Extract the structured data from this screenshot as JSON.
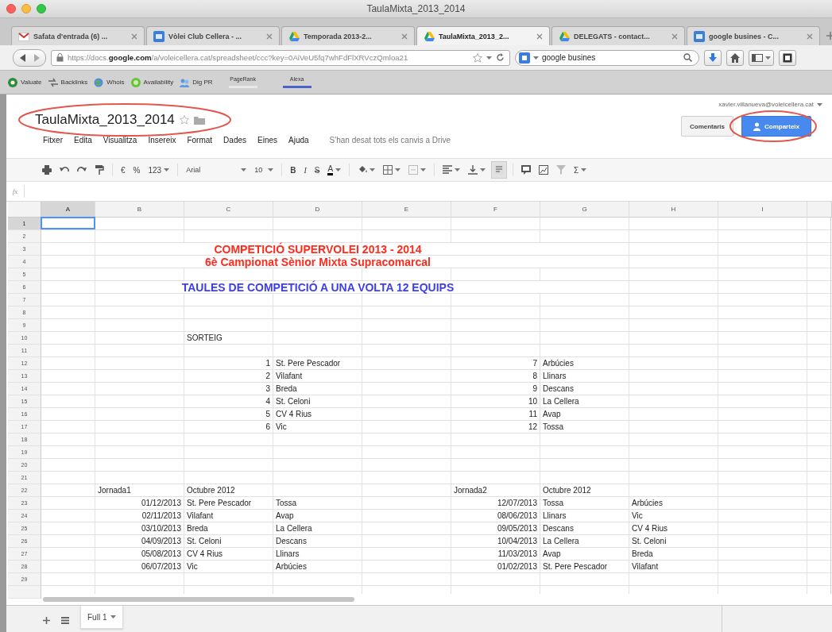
{
  "window": {
    "title": "TaulaMixta_2013_2014"
  },
  "tabs": [
    {
      "label": "Safata d'entrada (6) ...",
      "kind": "mail",
      "selected": false
    },
    {
      "label": "Vòlei Club Cellera - ...",
      "kind": "site",
      "selected": false
    },
    {
      "label": "Temporada 2013-2...",
      "kind": "drive",
      "selected": false
    },
    {
      "label": "TaulaMixta_2013_2...",
      "kind": "drive",
      "selected": true
    },
    {
      "label": "DELEGATS - contact...",
      "kind": "drive",
      "selected": false
    },
    {
      "label": "google busines - C...",
      "kind": "site",
      "selected": false
    }
  ],
  "address_bar": {
    "url": "https://docs.**google.com**/a/voleicellera.cat/spreadsheet/ccc?key=0AiVeU5fq7whFdFlXRVczQmloa21",
    "search": "google busines"
  },
  "bookmarks": [
    {
      "label": "Valuate",
      "kind": "link"
    },
    {
      "label": "Backlinks",
      "kind": "link"
    },
    {
      "label": "Whois",
      "kind": "link"
    },
    {
      "label": "Availability",
      "kind": "link"
    },
    {
      "label": "Dig PR",
      "kind": "link"
    },
    {
      "label": "PageRank",
      "kind": "meter",
      "color": "#e8e8e8"
    },
    {
      "label": "Alexa",
      "kind": "meter",
      "color": "#4a63c8"
    }
  ],
  "doc": {
    "title": "TaulaMixta_2013_2014",
    "title_highlighted": true,
    "account": "xavier.villanueva@voleicellera.cat",
    "menus": [
      "Fitxer",
      "Edita",
      "Visualitza",
      "Insereix",
      "Format",
      "Dades",
      "Eines",
      "Ajuda"
    ],
    "save_status": "S'han desat tots els canvis a Drive",
    "buttons": [
      {
        "label": "Comentaris",
        "kind": "plain",
        "highlighted": false
      },
      {
        "label": "Comparteix",
        "kind": "primary",
        "highlighted": true
      }
    ]
  },
  "toolbar": {
    "currency": "€",
    "percent": "%",
    "number_format": "123",
    "font": "Arial",
    "font_size": "10",
    "bold": "B",
    "italic": "I",
    "strikethrough": "S",
    "text_color": "A",
    "functions": "Σ"
  },
  "formula_bar": {
    "label": "fx"
  },
  "sheet": {
    "columns": [
      {
        "label": "A",
        "selected": true
      },
      {
        "label": "B",
        "selected": false
      },
      {
        "label": "C",
        "selected": false
      },
      {
        "label": "D",
        "selected": false
      },
      {
        "label": "E",
        "selected": false
      },
      {
        "label": "F",
        "selected": false
      },
      {
        "label": "G",
        "selected": false
      },
      {
        "label": "H",
        "selected": false
      },
      {
        "label": "I",
        "selected": false
      }
    ],
    "rows": [
      {
        "label": "1",
        "selected": true
      },
      {
        "label": "2",
        "selected": false
      },
      {
        "label": "3",
        "selected": false,
        "banner": {
          "text": "COMPETICIÓ SUPERVOLEI 2013 - 2014",
          "color": "#ff2b1c"
        }
      },
      {
        "label": "4",
        "selected": false,
        "banner": {
          "text": "6è Campionat Sènior Mixta Supracomarcal",
          "color": "#ff2b1c"
        }
      },
      {
        "label": "5",
        "selected": false
      },
      {
        "label": "6",
        "selected": false,
        "banner": {
          "text": "TAULES DE COMPETICIÓ A UNA VOLTA 12 EQUIPS",
          "color": "#3d3df2"
        }
      },
      {
        "label": "7",
        "selected": false
      },
      {
        "label": "8",
        "selected": false
      },
      {
        "label": "9",
        "selected": false
      },
      {
        "label": "10",
        "selected": false,
        "cells": [
          null,
          null,
          {
            "kind": "text",
            "text": "SORTEIG"
          }
        ]
      },
      {
        "label": "11",
        "selected": false
      },
      {
        "label": "12",
        "selected": false,
        "cells": [
          null,
          null,
          {
            "kind": "number",
            "text": "1"
          },
          {
            "kind": "text",
            "text": "St. Pere Pescador"
          },
          null,
          {
            "kind": "number",
            "text": "7"
          },
          {
            "kind": "text",
            "text": "Arbúcies"
          }
        ]
      },
      {
        "label": "13",
        "selected": false,
        "cells": [
          null,
          null,
          {
            "kind": "number",
            "text": "2"
          },
          {
            "kind": "text",
            "text": "Vilafant"
          },
          null,
          {
            "kind": "number",
            "text": "8"
          },
          {
            "kind": "text",
            "text": "Llinars"
          }
        ]
      },
      {
        "label": "14",
        "selected": false,
        "cells": [
          null,
          null,
          {
            "kind": "number",
            "text": "3"
          },
          {
            "kind": "text",
            "text": "Breda"
          },
          null,
          {
            "kind": "number",
            "text": "9"
          },
          {
            "kind": "text",
            "text": "Descans"
          }
        ]
      },
      {
        "label": "15",
        "selected": false,
        "cells": [
          null,
          null,
          {
            "kind": "number",
            "text": "4"
          },
          {
            "kind": "text",
            "text": "St. Celoni"
          },
          null,
          {
            "kind": "number",
            "text": "10"
          },
          {
            "kind": "text",
            "text": "La Cellera"
          }
        ]
      },
      {
        "label": "16",
        "selected": false,
        "cells": [
          null,
          null,
          {
            "kind": "number",
            "text": "5"
          },
          {
            "kind": "text",
            "text": "CV 4 Rius"
          },
          null,
          {
            "kind": "number",
            "text": "11"
          },
          {
            "kind": "text",
            "text": "Avap"
          }
        ]
      },
      {
        "label": "17",
        "selected": false,
        "cells": [
          null,
          null,
          {
            "kind": "number",
            "text": "6"
          },
          {
            "kind": "text",
            "text": "Vic"
          },
          null,
          {
            "kind": "number",
            "text": "12"
          },
          {
            "kind": "text",
            "text": "Tossa"
          }
        ]
      },
      {
        "label": "18",
        "selected": false
      },
      {
        "label": "19",
        "selected": false
      },
      {
        "label": "20",
        "selected": false
      },
      {
        "label": "21",
        "selected": false
      },
      {
        "label": "22",
        "selected": false,
        "cells": [
          null,
          {
            "kind": "text",
            "text": "Jornada1"
          },
          {
            "kind": "text",
            "text": "Octubre 2012"
          },
          null,
          null,
          {
            "kind": "text",
            "text": "Jornada2"
          },
          {
            "kind": "text",
            "text": "Octubre 2012"
          }
        ]
      },
      {
        "label": "23",
        "selected": false,
        "cells": [
          null,
          {
            "kind": "number",
            "text": "01/12/2013"
          },
          {
            "kind": "text",
            "text": "St. Pere Pescador"
          },
          {
            "kind": "text",
            "text": "Tossa"
          },
          null,
          {
            "kind": "number",
            "text": "12/07/2013"
          },
          {
            "kind": "text",
            "text": "Tossa"
          },
          {
            "kind": "text",
            "text": "Arbúcies"
          }
        ]
      },
      {
        "label": "24",
        "selected": false,
        "cells": [
          null,
          {
            "kind": "number",
            "text": "02/11/2013"
          },
          {
            "kind": "text",
            "text": "Vilafant"
          },
          {
            "kind": "text",
            "text": "Avap"
          },
          null,
          {
            "kind": "number",
            "text": "08/06/2013"
          },
          {
            "kind": "text",
            "text": "Llinars"
          },
          {
            "kind": "text",
            "text": "Vic"
          }
        ]
      },
      {
        "label": "25",
        "selected": false,
        "cells": [
          null,
          {
            "kind": "number",
            "text": "03/10/2013"
          },
          {
            "kind": "text",
            "text": "Breda"
          },
          {
            "kind": "text",
            "text": "La Cellera"
          },
          null,
          {
            "kind": "number",
            "text": "09/05/2013"
          },
          {
            "kind": "text",
            "text": "Descans"
          },
          {
            "kind": "text",
            "text": "CV 4 Rius"
          }
        ]
      },
      {
        "label": "26",
        "selected": false,
        "cells": [
          null,
          {
            "kind": "number",
            "text": "04/09/2013"
          },
          {
            "kind": "text",
            "text": "St. Celoni"
          },
          {
            "kind": "text",
            "text": "Descans"
          },
          null,
          {
            "kind": "number",
            "text": "10/04/2013"
          },
          {
            "kind": "text",
            "text": "La Cellera"
          },
          {
            "kind": "text",
            "text": "St. Celoni"
          }
        ]
      },
      {
        "label": "27",
        "selected": false,
        "cells": [
          null,
          {
            "kind": "number",
            "text": "05/08/2013"
          },
          {
            "kind": "text",
            "text": "CV 4 Rius"
          },
          {
            "kind": "text",
            "text": "Llinars"
          },
          null,
          {
            "kind": "number",
            "text": "11/03/2013"
          },
          {
            "kind": "text",
            "text": "Avap"
          },
          {
            "kind": "text",
            "text": "Breda"
          }
        ]
      },
      {
        "label": "28",
        "selected": false,
        "cells": [
          null,
          {
            "kind": "number",
            "text": "06/07/2013"
          },
          {
            "kind": "text",
            "text": "Vic"
          },
          {
            "kind": "text",
            "text": "Arbúcies"
          },
          null,
          {
            "kind": "number",
            "text": "01/02/2013"
          },
          {
            "kind": "text",
            "text": "St. Pere Pescador"
          },
          {
            "kind": "text",
            "text": "Vilafant"
          }
        ]
      },
      {
        "label": "29",
        "selected": false
      }
    ]
  },
  "sheet_tabs": [
    {
      "label": "Full 1",
      "selected": true
    }
  ]
}
